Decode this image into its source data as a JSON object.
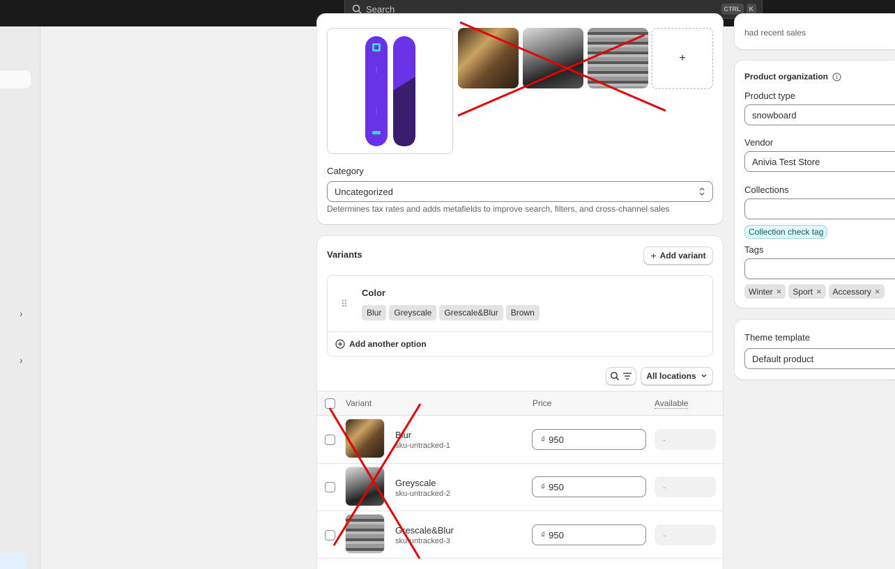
{
  "topbar": {
    "search_placeholder": "Search",
    "kbd_ctrl": "CTRL",
    "kbd_k": "K"
  },
  "media": {
    "add_label": "+"
  },
  "category": {
    "label": "Category",
    "value": "Uncategorized",
    "help": "Determines tax rates and adds metafields to improve search, filters, and cross-channel sales"
  },
  "variants": {
    "title": "Variants",
    "add_variant": "Add variant",
    "option_name": "Color",
    "option_values": [
      "Blur",
      "Greyscale",
      "Grescale&Blur",
      "Brown"
    ],
    "add_option": "Add another option",
    "locations": "All locations",
    "columns": {
      "variant": "Variant",
      "price": "Price",
      "available": "Available"
    },
    "rows": [
      {
        "name": "Blur",
        "sku": "sku-untracked-1",
        "currency": "₫",
        "price": "950",
        "available": "-"
      },
      {
        "name": "Greyscale",
        "sku": "sku-untracked-2",
        "currency": "₫",
        "price": "950",
        "available": "-"
      },
      {
        "name": "Grescale&Blur",
        "sku": "sku-untracked-3",
        "currency": "₫",
        "price": "950",
        "available": "-"
      }
    ]
  },
  "side": {
    "recent_sales": "had recent sales",
    "org_title": "Product organization",
    "product_type_label": "Product type",
    "product_type": "snowboard",
    "vendor_label": "Vendor",
    "vendor": "Anivia Test Store",
    "collections_label": "Collections",
    "collection_tag": "Collection check tag",
    "tags_label": "Tags",
    "tags": [
      "Winter",
      "Sport",
      "Accessory"
    ],
    "theme_label": "Theme template",
    "theme_value": "Default product"
  },
  "colors": {
    "accent_red": "#e30000",
    "topbar": "#1a1a1a",
    "snowboard": "#6a32e6"
  }
}
